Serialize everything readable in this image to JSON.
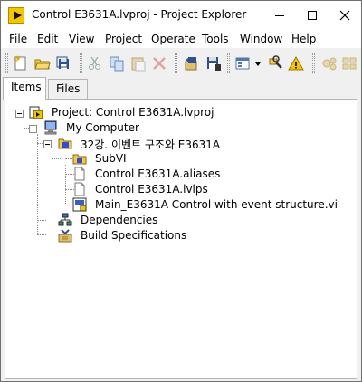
{
  "window": {
    "title": "Control E3631A.lvproj - Project Explorer"
  },
  "menu": [
    "File",
    "Edit",
    "View",
    "Project",
    "Operate",
    "Tools",
    "Window",
    "Help"
  ],
  "toolbar": {
    "buttons": [
      {
        "icon": "new-icon"
      },
      {
        "icon": "open-icon"
      },
      {
        "icon": "save-all-icon"
      },
      {
        "icon": "cut-icon"
      },
      {
        "icon": "copy-icon"
      },
      {
        "icon": "paste-icon"
      },
      {
        "icon": "delete-icon"
      },
      {
        "icon": "build-icon"
      },
      {
        "icon": "save-build-icon"
      },
      {
        "icon": "view-dropdown-icon"
      },
      {
        "icon": "wrench-icon"
      },
      {
        "icon": "warning-icon"
      },
      {
        "icon": "deploy-icon"
      },
      {
        "icon": "deploy-all-icon"
      }
    ]
  },
  "tabs": [
    {
      "label": "Items",
      "active": true
    },
    {
      "label": "Files",
      "active": false
    }
  ],
  "tree": {
    "project": "Project: Control E3631A.lvproj",
    "my_computer": "My Computer",
    "folder": "32강. 이벤트 구조와 E3631A",
    "items": [
      {
        "label": "SubVI",
        "icon": "folder-icon"
      },
      {
        "label": "Control E3631A.aliases",
        "icon": "file-icon"
      },
      {
        "label": "Control E3631A.lvlps",
        "icon": "file-icon"
      },
      {
        "label": "Main_E3631A Control with event structure.vi",
        "icon": "vi-icon"
      }
    ],
    "dependencies": "Dependencies",
    "build_specs": "Build Specifications"
  }
}
